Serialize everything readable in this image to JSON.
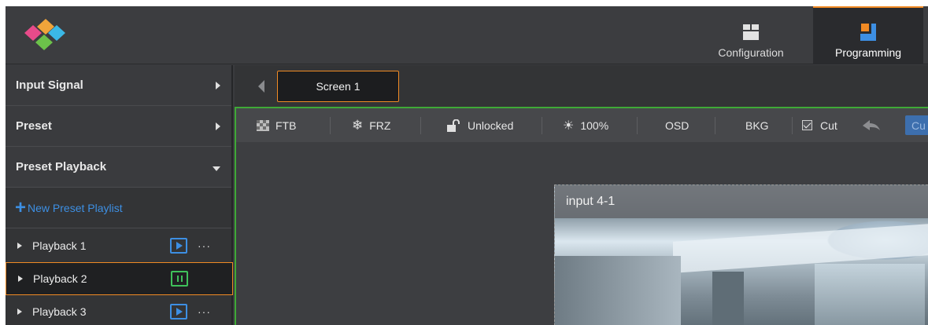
{
  "header": {
    "nav": [
      {
        "label": "Configuration",
        "icon": "configuration-icon"
      },
      {
        "label": "Programming",
        "icon": "programming-icon",
        "active": true
      }
    ],
    "accent_color": "#f08a24"
  },
  "sidebar": {
    "sections": [
      {
        "label": "Input Signal",
        "expanded": false
      },
      {
        "label": "Preset",
        "expanded": false
      },
      {
        "label": "Preset Playback",
        "expanded": true
      }
    ],
    "new_playlist_label": "New Preset Playlist",
    "playbacks": [
      {
        "label": "Playback 1",
        "state": "stopped",
        "more": "···"
      },
      {
        "label": "Playback 2",
        "state": "playing",
        "selected": true
      },
      {
        "label": "Playback 3",
        "state": "stopped",
        "more": "···"
      }
    ]
  },
  "screens": {
    "tabs": [
      {
        "label": "Screen 1",
        "active": true
      }
    ]
  },
  "toolbar": {
    "ftb": "FTB",
    "frz": "FRZ",
    "lock": "Unlocked",
    "brightness": "100%",
    "osd": "OSD",
    "bkg": "BKG",
    "cut_check": "Cut",
    "cut_checked": true,
    "cut_button": "Cu"
  },
  "canvas": {
    "layer_title": "input 4-1"
  }
}
